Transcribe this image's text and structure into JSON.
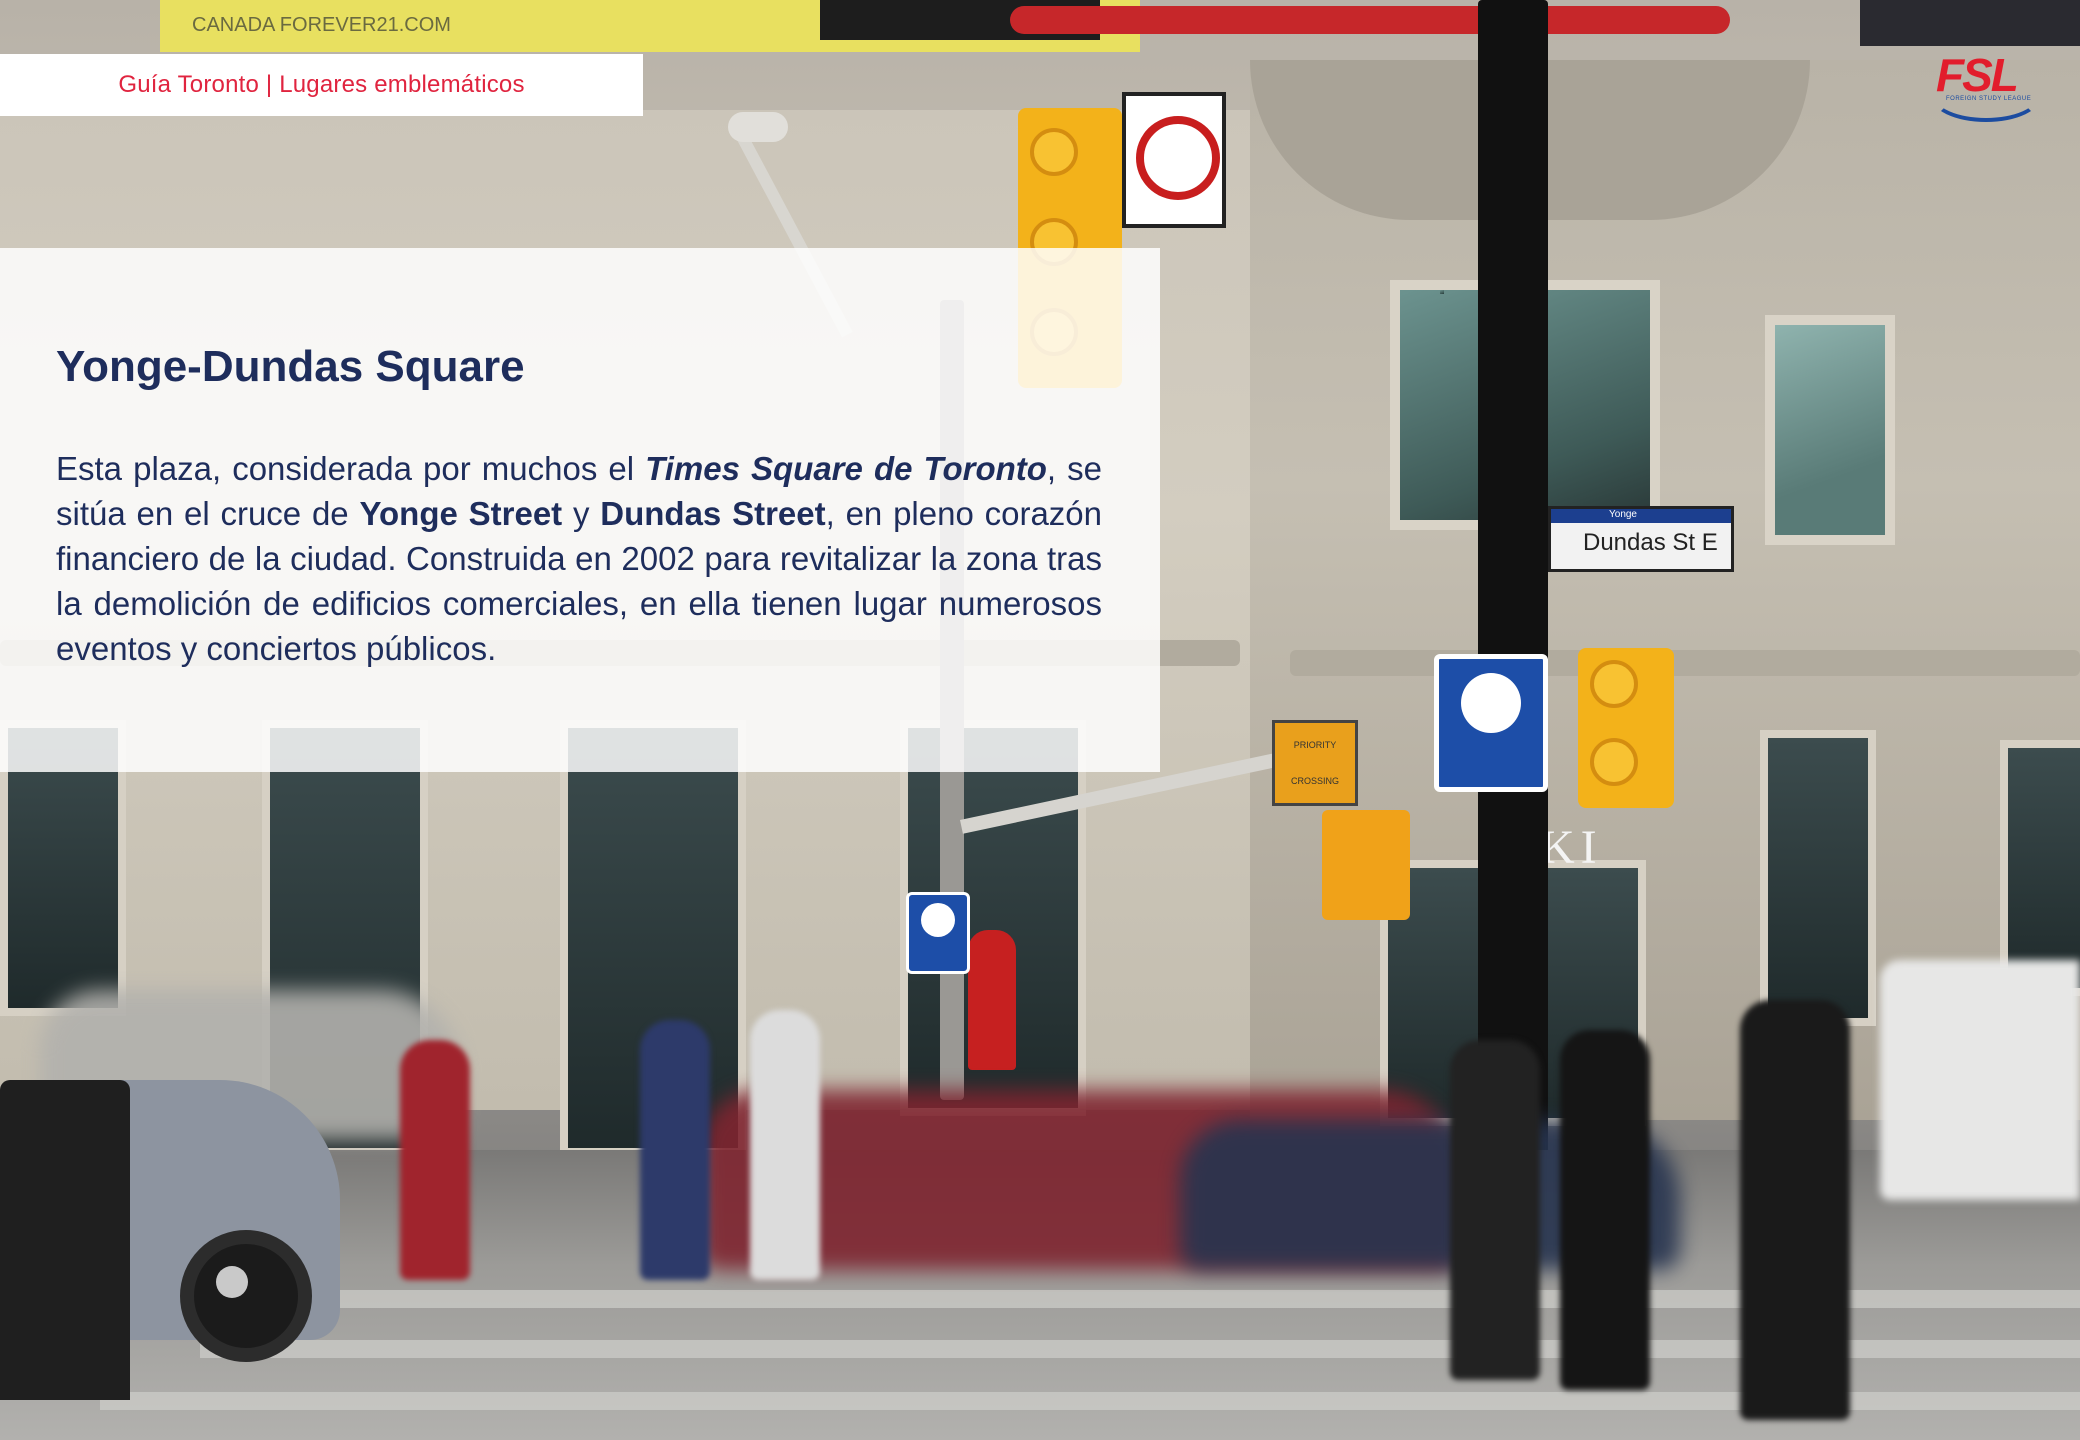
{
  "header": {
    "label": "Guía Toronto | Lugares emblemáticos",
    "accent_color": "#e0243f"
  },
  "logo": {
    "text": "FSL",
    "subtext": "FOREIGN STUDY LEAGUE",
    "colors": [
      "#e21d2c",
      "#1c4ca0"
    ]
  },
  "background_signs": {
    "banner": "CANADA FOREVER21.COM",
    "street_sign": "Dundas St E",
    "street_sign_top": "Yonge",
    "priority_sign": "PRIORITY CROSSING",
    "store_letters": "KI"
  },
  "card": {
    "title": "Yonge-Dundas Square",
    "title_color": "#1e2d5c",
    "body": {
      "p1": "Esta plaza, considerada por muchos el ",
      "b1": "Times Square de Toronto",
      "p2": ", se sitúa en el cruce de ",
      "b2": "Yonge Street",
      "p3": " y ",
      "b3": "Dundas Street",
      "p4": ", en pleno corazón financiero de la ciudad. Construida en 2002 para revitalizar la zona tras la demolición de edificios comerciales, en ella tienen lugar numerosos eventos y conciertos públicos."
    }
  }
}
